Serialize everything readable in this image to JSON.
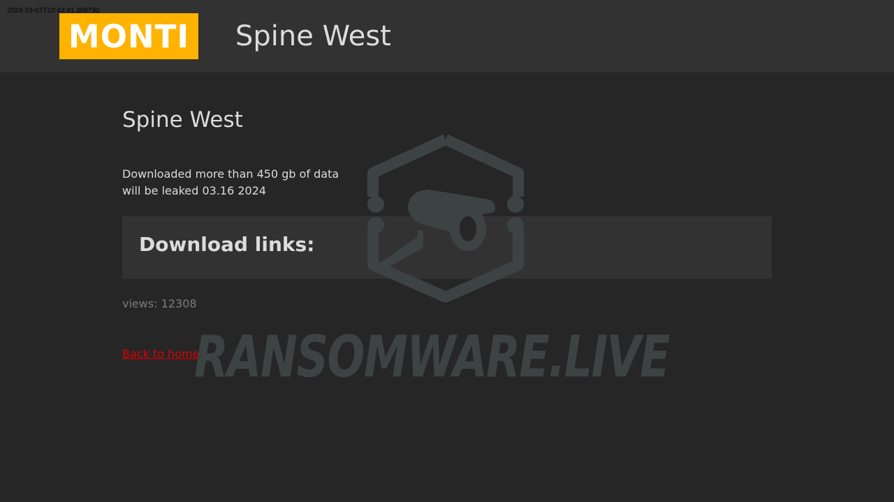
{
  "timestamp": "2024-03-07T10:43:41.309730",
  "header": {
    "logo_text": "MONTI",
    "title": "Spine West"
  },
  "post": {
    "title": "Spine West",
    "description_line1": "Downloaded more than 450 gb of data",
    "description_line2": "will be leaked 03.16 2024",
    "download_heading": "Download links:",
    "views": "views: 12308",
    "back_link": "Back to home"
  },
  "watermark": {
    "text": "RANSOMWARE.LIVE",
    "icon": "security-camera-hexagon-icon"
  },
  "colors": {
    "background": "#262626",
    "topbar": "#323232",
    "logo_bg": "#ffb300",
    "text": "#dcdcdc",
    "muted": "#7c7c7c",
    "link": "#e00000",
    "watermark": "#3d4342"
  }
}
